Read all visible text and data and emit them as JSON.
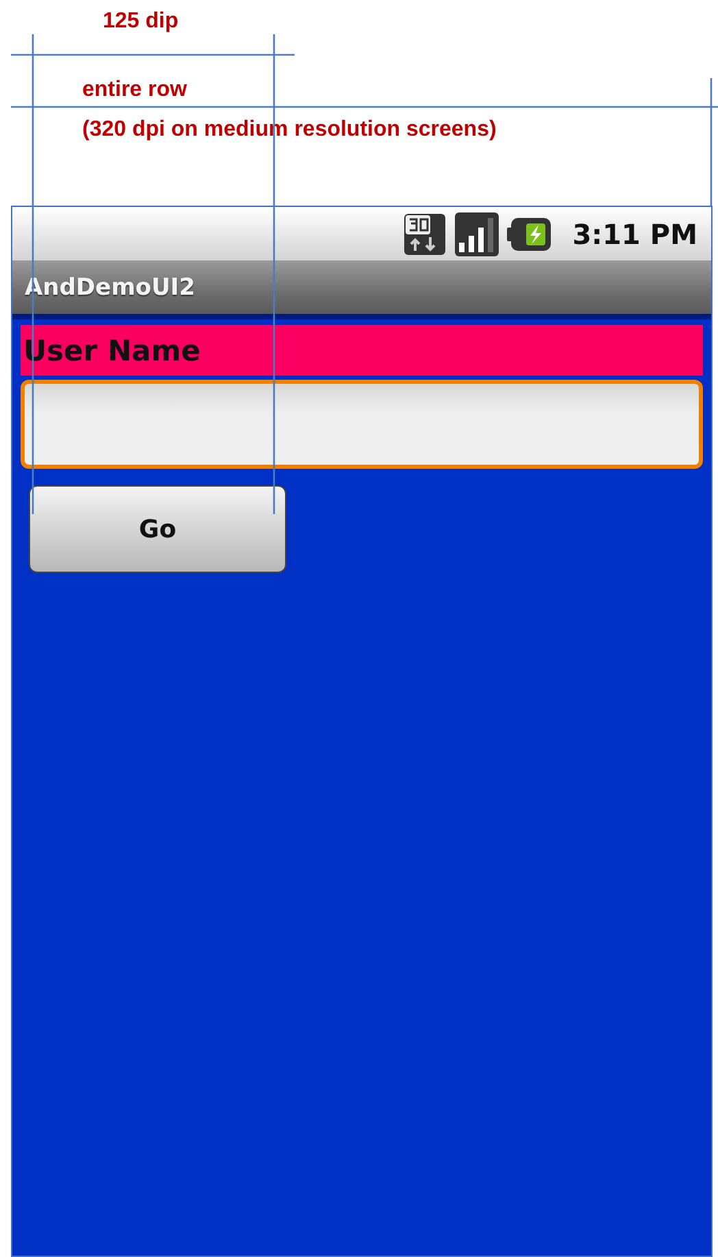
{
  "annotations": [
    {
      "text": "125 dip"
    },
    {
      "text": "entire row"
    },
    {
      "text": "(320 dpi on medium resolution screens)"
    }
  ],
  "status_bar": {
    "time": "3:11 PM"
  },
  "app_title": "AndDemoUI2",
  "label": "User Name",
  "field": {
    "focused": true
  },
  "button": {
    "label": "Go"
  }
}
